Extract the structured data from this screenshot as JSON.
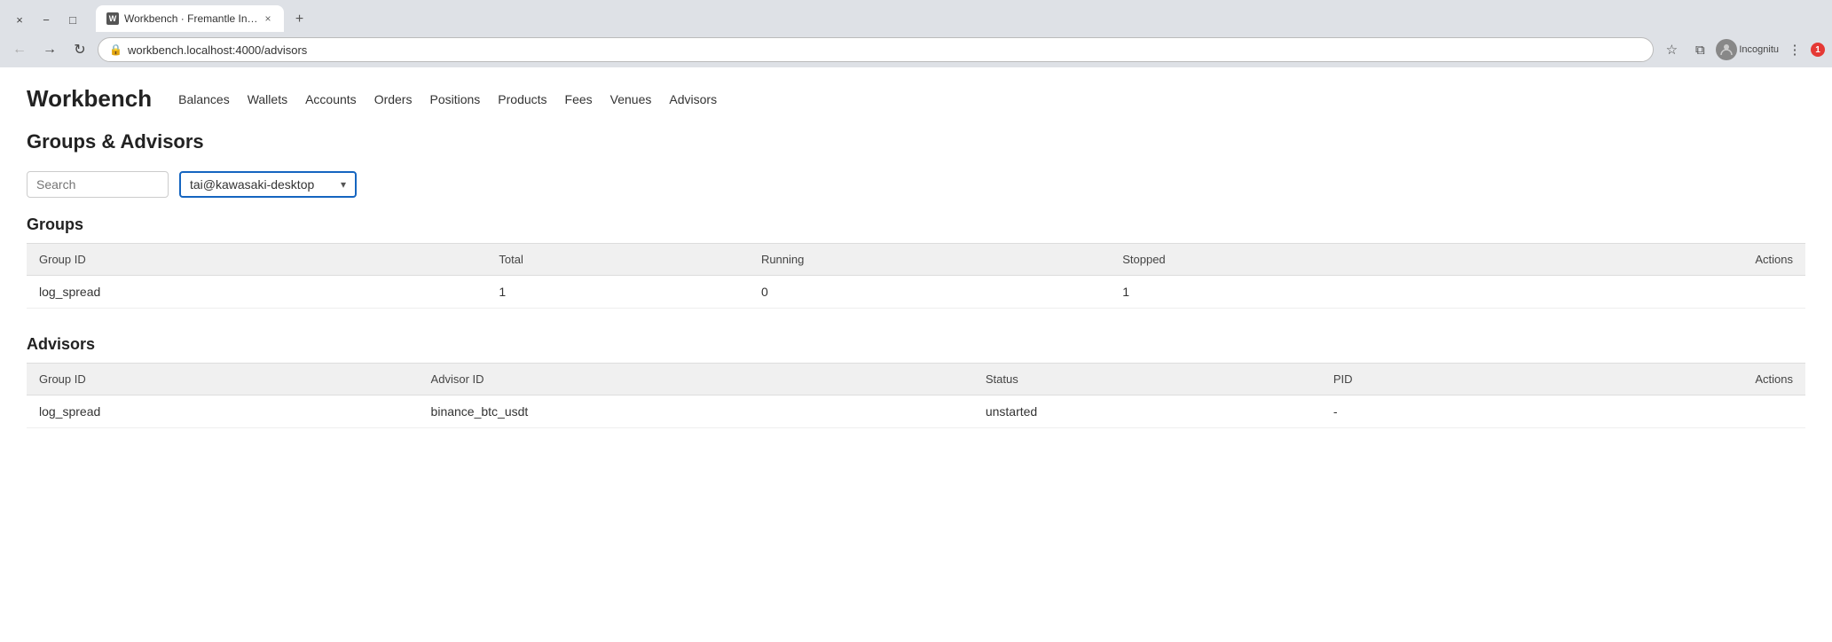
{
  "browser": {
    "tab": {
      "title": "Workbench · Fremantle In…",
      "favicon": "W"
    },
    "new_tab_label": "+",
    "window_controls": {
      "minimize": "−",
      "maximize": "□",
      "close": "×"
    },
    "nav": {
      "back": "←",
      "forward": "→",
      "reload": "↻"
    },
    "address": "workbench.localhost:4000/advisors",
    "toolbar": {
      "star": "☆",
      "puzzle": "⧉",
      "more": "⋮"
    },
    "incognito_label": "Incognitu",
    "notification_count": "1"
  },
  "app": {
    "logo": "Workbench",
    "nav": [
      {
        "label": "Balances",
        "href": "/balances"
      },
      {
        "label": "Wallets",
        "href": "/wallets"
      },
      {
        "label": "Accounts",
        "href": "/accounts"
      },
      {
        "label": "Orders",
        "href": "/orders"
      },
      {
        "label": "Positions",
        "href": "/positions"
      },
      {
        "label": "Products",
        "href": "/products"
      },
      {
        "label": "Fees",
        "href": "/fees"
      },
      {
        "label": "Venues",
        "href": "/venues"
      },
      {
        "label": "Advisors",
        "href": "/advisors"
      }
    ]
  },
  "page": {
    "title": "Groups & Advisors",
    "search_placeholder": "Search",
    "dropdown_selected": "tai@kawasaki-desktop",
    "groups_section": {
      "title": "Groups",
      "columns": [
        "Group ID",
        "Total",
        "Running",
        "Stopped",
        "Actions"
      ],
      "rows": [
        {
          "group_id": "log_spread",
          "total": "1",
          "running": "0",
          "stopped": "1",
          "actions": ""
        }
      ]
    },
    "advisors_section": {
      "title": "Advisors",
      "columns": [
        "Group ID",
        "Advisor ID",
        "Status",
        "PID",
        "Actions"
      ],
      "rows": [
        {
          "group_id": "log_spread",
          "advisor_id": "binance_btc_usdt",
          "status": "unstarted",
          "pid": "-",
          "actions": ""
        }
      ]
    }
  }
}
